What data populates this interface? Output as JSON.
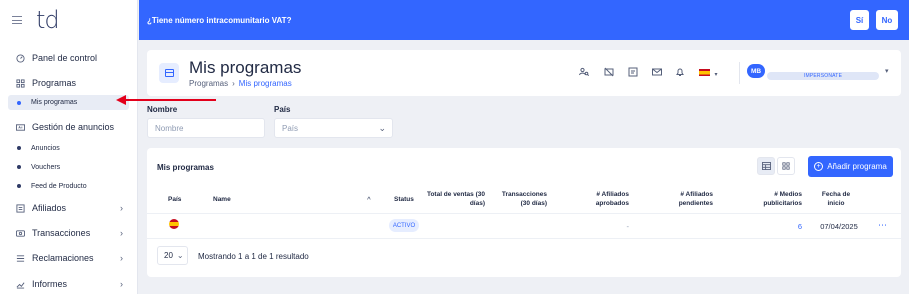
{
  "app": {
    "logo_text": "td"
  },
  "banner": {
    "question": "¿Tiene número intracomunitario VAT?",
    "yes_label": "Sí",
    "no_label": "No"
  },
  "sidebar": {
    "items": [
      {
        "label": "Panel de control",
        "icon": "dashboard-icon"
      },
      {
        "label": "Programas",
        "icon": "grid-icon"
      },
      {
        "label": "Mis programas",
        "icon": "dot-icon",
        "active": true
      },
      {
        "label": "Gestión de anuncios",
        "icon": "ad-icon"
      },
      {
        "label": "Anuncios",
        "icon": "dot-icon"
      },
      {
        "label": "Vouchers",
        "icon": "dot-icon"
      },
      {
        "label": "Feed de Producto",
        "icon": "dot-icon"
      },
      {
        "label": "Afiliados",
        "icon": "affiliates-icon"
      },
      {
        "label": "Transacciones",
        "icon": "transactions-icon"
      },
      {
        "label": "Reclamaciones",
        "icon": "claims-icon"
      },
      {
        "label": "Informes",
        "icon": "chart-icon"
      }
    ]
  },
  "header": {
    "title": "Mis programas",
    "breadcrumb": {
      "parent": "Programas",
      "separator": "›",
      "current": "Mis programas"
    },
    "user_initials": "MB",
    "impersonate_label": "IMPERSONATE"
  },
  "filters": {
    "name_label": "Nombre",
    "name_placeholder": "Nombre",
    "country_label": "País",
    "country_placeholder": "País"
  },
  "table": {
    "title": "Mis programas",
    "add_button_label": "Añadir programa",
    "columns": {
      "country": "País",
      "name": "Name",
      "sort_indicator": "^",
      "status": "Status",
      "sales": "Total de ventas (30 días)",
      "transactions": "Transacciones (30 días)",
      "approved_affiliates": "# Afiliados aprobados",
      "pending_affiliates": "# Afiliados pendientes",
      "media": "# Medios publicitarios",
      "start_date": "Fecha de inicio"
    },
    "rows": [
      {
        "name": "",
        "status": "ACTIVO",
        "sales": "",
        "transactions": "",
        "approved_affiliates": "-",
        "pending_affiliates": "",
        "media": "6",
        "start_date": "07/04/2025",
        "actions": "⋯"
      }
    ],
    "page_size": "20",
    "result_text": "Mostrando 1 a 1 de 1 resultado"
  },
  "colors": {
    "primary": "#3366ff",
    "annotation_arrow": "#e3001b",
    "status_badge_bg": "#e6edff"
  }
}
